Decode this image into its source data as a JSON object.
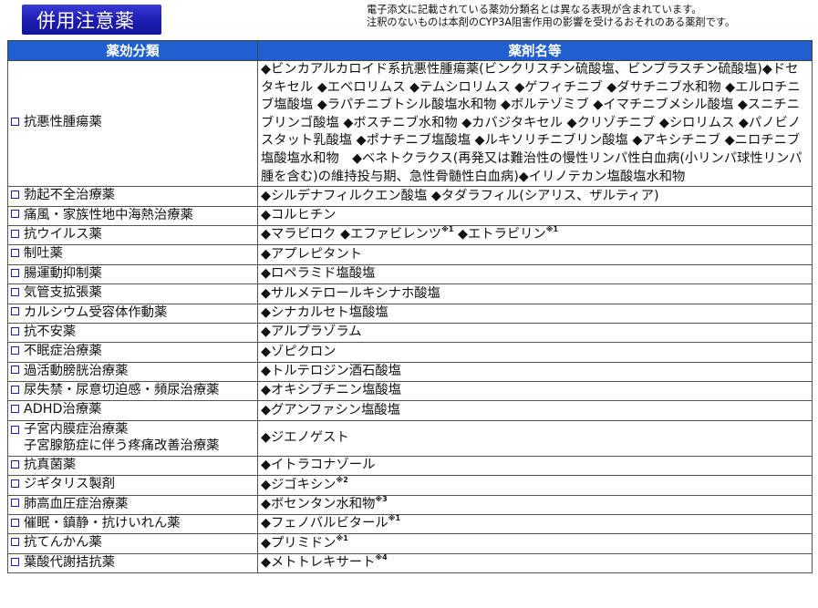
{
  "title": "併用注意薬",
  "notes": [
    "電子添文に記載されている薬効分類名とは異なる表現が含まれています。",
    "注釈のないものは本剤のCYP3A阻害作用の影響を受けるおそれのある薬剤です。"
  ],
  "table": {
    "headers": [
      "薬効分類",
      "薬剤名等"
    ],
    "checkbox_color": "#1f1fa8",
    "header_color": "#1f5fd0",
    "rows": [
      {
        "category": "抗悪性腫瘍薬",
        "drugs": "◆ビンカアルカロイド系抗悪性腫瘍薬(ビンクリスチン硫酸塩、ビンブラスチン硫酸塩)◆ドセタキセル ◆エベロリムス ◆テムシロリムス ◆ゲフィチニブ ◆ダサチニブ水和物 ◆エルロチニブ塩酸塩 ◆ラパチニブトシル酸塩水和物 ◆ボルテゾミブ ◆イマチニブメシル酸塩 ◆スニチニブリンゴ酸塩 ◆ボスチニブ水和物 ◆カバジタキセル ◆クリゾチニブ ◆シロリムス ◆パノビノスタット乳酸塩 ◆ポナチニブ塩酸塩 ◆ルキソリチニブリン酸塩 ◆アキシチニブ ◆ニロチニブ塩酸塩水和物　◆ベネトクラクス(再発又は難治性の慢性リンパ性白血病(小リンパ球性リンパ腫を含む)の維持投与期、急性骨髄性白血病)◆イリノテカン塩酸塩水和物",
        "note": ""
      },
      {
        "category": "勃起不全治療薬",
        "drugs": "◆シルデナフィルクエン酸塩 ◆タダラフィル(シアリス、ザルティア)",
        "note": ""
      },
      {
        "category": "痛風・家族性地中海熱治療薬",
        "drugs": "◆コルヒチン",
        "note": ""
      },
      {
        "category": "抗ウイルス薬",
        "drugs": "◆マラビロク ◆エファビレンツ",
        "note": "※1",
        "drugs2": " ◆エトラビリン",
        "note2": "※1"
      },
      {
        "category": "制吐薬",
        "drugs": "◆アプレピタント",
        "note": ""
      },
      {
        "category": "腸運動抑制薬",
        "drugs": "◆ロペラミド塩酸塩",
        "note": ""
      },
      {
        "category": "気管支拡張薬",
        "drugs": "◆サルメテロールキシナホ酸塩",
        "note": ""
      },
      {
        "category": "カルシウム受容体作動薬",
        "drugs": "◆シナカルセト塩酸塩",
        "note": ""
      },
      {
        "category": "抗不安薬",
        "drugs": "◆アルプラゾラム",
        "note": ""
      },
      {
        "category": "不眠症治療薬",
        "drugs": "◆ゾピクロン",
        "note": ""
      },
      {
        "category": "過活動膀胱治療薬",
        "drugs": "◆トルテロジン酒石酸塩",
        "note": ""
      },
      {
        "category": "尿失禁・尿意切迫感・頻尿治療薬",
        "drugs": "◆オキシブチニン塩酸塩",
        "note": ""
      },
      {
        "category": "ADHD治療薬",
        "drugs": "◆グアンファシン塩酸塩",
        "note": ""
      },
      {
        "category": "子宮内膜症治療薬",
        "category2": "子宮腺筋症に伴う疼痛改善治療薬",
        "drugs": "◆ジエノゲスト",
        "note": ""
      },
      {
        "category": "抗真菌薬",
        "drugs": "◆イトラコナゾール",
        "note": ""
      },
      {
        "category": "ジギタリス製剤",
        "drugs": "◆ジゴキシン",
        "note": "※2"
      },
      {
        "category": "肺高血圧症治療薬",
        "drugs": "◆ボセンタン水和物",
        "note": "※3"
      },
      {
        "category": "催眠・鎮静・抗けいれん薬",
        "drugs": "◆フェノバルビタール",
        "note": "※1"
      },
      {
        "category": "抗てんかん薬",
        "drugs": "◆プリミドン",
        "note": "※1"
      },
      {
        "category": "葉酸代謝拮抗薬",
        "drugs": "◆メトトレキサート",
        "note": "※4"
      }
    ]
  }
}
